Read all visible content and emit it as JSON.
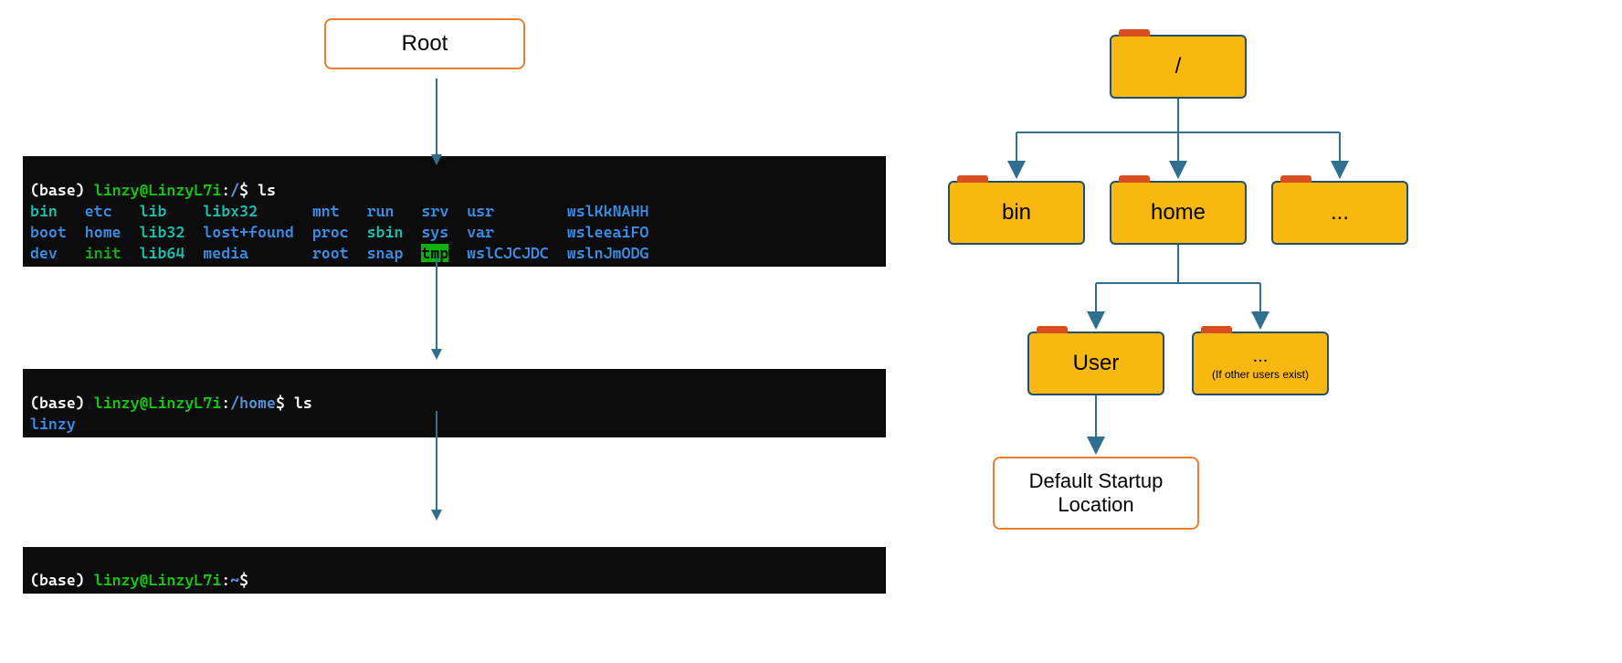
{
  "root_label": "Root",
  "terminal1": {
    "prompt_base": "(base) ",
    "prompt_userhost": "linzy@LinzyL7i",
    "prompt_colon": ":",
    "prompt_path": "/",
    "prompt_dollar": "$ ",
    "cmd": "ls",
    "row1": {
      "c0": "bin",
      "c1": "etc",
      "c2": "lib",
      "c3": "libx32",
      "c4": "mnt",
      "c5": "run",
      "c6": "srv",
      "c7": "usr",
      "c8": "wslKkNAHH"
    },
    "row2": {
      "c0": "boot",
      "c1": "home",
      "c2": "lib32",
      "c3": "lost+found",
      "c4": "proc",
      "c5": "sbin",
      "c6": "sys",
      "c7": "var",
      "c8": "wsleeaiFO"
    },
    "row3": {
      "c0": "dev",
      "c1": "init",
      "c2": "lib64",
      "c3": "media",
      "c4": "root",
      "c5": "snap",
      "c6": "tmp",
      "c7": "wslCJCJDC",
      "c8": "wslnJmODG"
    }
  },
  "terminal2": {
    "prompt_base": "(base) ",
    "prompt_userhost": "linzy@LinzyL7i",
    "prompt_colon": ":",
    "prompt_path": "/home",
    "prompt_dollar": "$ ",
    "cmd": "ls",
    "row1": "linzy"
  },
  "terminal3": {
    "prompt_base": "(base) ",
    "prompt_userhost": "linzy@LinzyL7i",
    "prompt_colon": ":",
    "prompt_path": "~",
    "prompt_dollar": "$"
  },
  "folders": {
    "root": "/",
    "bin": "bin",
    "home": "home",
    "dots": "...",
    "user": "User",
    "other_main": "...",
    "other_sub": "(If other users exist)"
  },
  "startup_label": "Default Startup Location",
  "colors": {
    "terminal_blue": "#3a8ee6",
    "terminal_cyan": "#17c2b2",
    "terminal_green": "#10b010",
    "folder_fill": "#f9b80f",
    "folder_tab": "#d94e21",
    "diagram_line": "#2f6f8f",
    "orange_border": "#ed7d31"
  }
}
